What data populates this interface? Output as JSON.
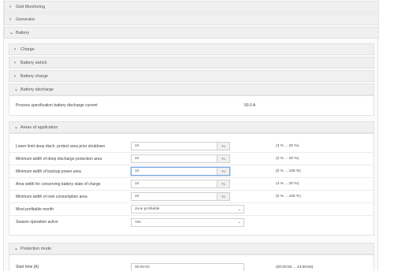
{
  "sections": {
    "grid_monitoring": "Grid Monitoring",
    "generator": "Generator",
    "battery": "Battery"
  },
  "battery": {
    "charge": "Charge",
    "battery_switch": "Battery switch",
    "battery_charge": "Battery charge",
    "battery_discharge": "Battery discharge",
    "discharge_row": {
      "label": "Process specification battery discharge current",
      "value": "50.0 A"
    },
    "areas_header": "Areas of application",
    "areas": [
      {
        "label": "Lower limit deep disch. protect area prior shutdown",
        "value": "10",
        "unit": "%",
        "range": "(3 % ... 20 %)"
      },
      {
        "label": "Minimum width of deep discharge protection area",
        "value": "10",
        "unit": "%",
        "range": "(2 % ... 20 %)"
      },
      {
        "label": "Minimum width of backup power area",
        "value": "10",
        "unit": "%",
        "range": "(0 % ... 100 %)"
      },
      {
        "label": "Area width for conserving battery state of charge",
        "value": "10",
        "unit": "%",
        "range": "(4 % ... 20 %)"
      },
      {
        "label": "Minimum width of own consumption area",
        "value": "10",
        "unit": "%",
        "range": "(0 % ... 100 %)"
      }
    ],
    "most_profitable_month": {
      "label": "Most profitable month",
      "value": "June profitable"
    },
    "season_operation": {
      "label": "Season operation active",
      "value": "Yes"
    },
    "protection_header": "Protection mode",
    "start_time": {
      "label": "Start time [A]",
      "value": "00:00:00",
      "range": "(00:00:00 ... 23:59:59)"
    }
  },
  "icons": {
    "collapsed": "›",
    "expanded": "⌄",
    "dropdown": "⌄"
  }
}
